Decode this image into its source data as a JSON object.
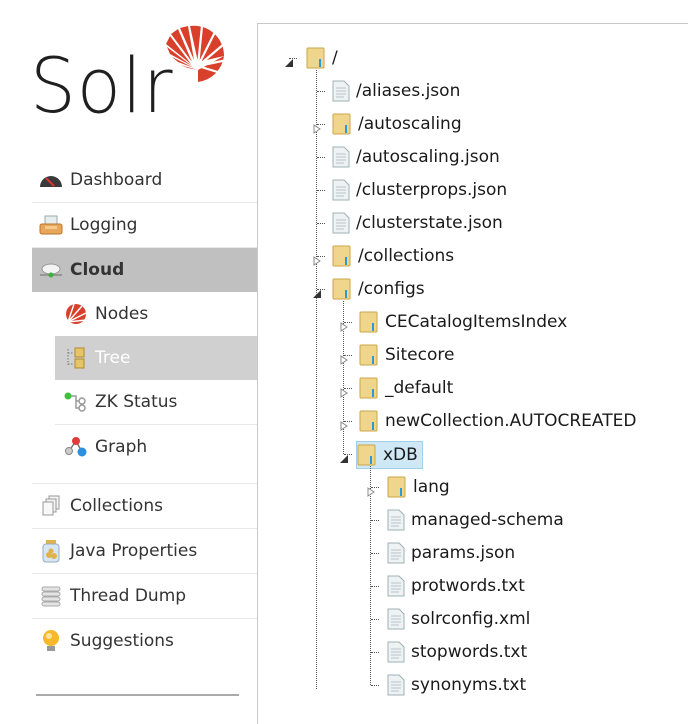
{
  "app": {
    "logo_text": "Solr",
    "brand_color": "#d9402b"
  },
  "sidebar": {
    "items": [
      {
        "label": "Dashboard",
        "icon": "dashboard-gauge-icon"
      },
      {
        "label": "Logging",
        "icon": "logging-tray-icon"
      },
      {
        "label": "Cloud",
        "icon": "cloud-icon",
        "active": true
      },
      {
        "label": "Collections",
        "icon": "collections-icon"
      },
      {
        "label": "Java Properties",
        "icon": "java-jar-icon"
      },
      {
        "label": "Thread Dump",
        "icon": "thread-dump-icon"
      },
      {
        "label": "Suggestions",
        "icon": "lightbulb-icon"
      }
    ],
    "cloud_sub_items": [
      {
        "label": "Nodes",
        "icon": "solr-nodes-icon"
      },
      {
        "label": "Tree",
        "icon": "tree-icon",
        "selected": true
      },
      {
        "label": "ZK Status",
        "icon": "zk-status-icon"
      },
      {
        "label": "Graph",
        "icon": "graph-icon"
      }
    ]
  },
  "tree": {
    "root": {
      "label": "/",
      "type": "folder",
      "expanded": true
    },
    "children": [
      {
        "label": "/aliases.json",
        "type": "file"
      },
      {
        "label": "/autoscaling",
        "type": "folder",
        "expanded": false
      },
      {
        "label": "/autoscaling.json",
        "type": "file"
      },
      {
        "label": "/clusterprops.json",
        "type": "file"
      },
      {
        "label": "/clusterstate.json",
        "type": "file"
      },
      {
        "label": "/collections",
        "type": "folder",
        "expanded": false
      },
      {
        "label": "/configs",
        "type": "folder",
        "expanded": true
      }
    ],
    "configs_children": [
      {
        "label": "CECatalogItemsIndex",
        "type": "folder",
        "expanded": false
      },
      {
        "label": "Sitecore",
        "type": "folder",
        "expanded": false
      },
      {
        "label": "_default",
        "type": "folder",
        "expanded": false
      },
      {
        "label": "newCollection.AUTOCREATED",
        "type": "folder",
        "expanded": false
      },
      {
        "label": "xDB",
        "type": "folder",
        "expanded": true,
        "selected": true
      }
    ],
    "xdb_children": [
      {
        "label": "lang",
        "type": "folder",
        "expanded": false
      },
      {
        "label": "managed-schema",
        "type": "file"
      },
      {
        "label": "params.json",
        "type": "file"
      },
      {
        "label": "protwords.txt",
        "type": "file"
      },
      {
        "label": "solrconfig.xml",
        "type": "file"
      },
      {
        "label": "stopwords.txt",
        "type": "file"
      },
      {
        "label": "synonyms.txt",
        "type": "file"
      }
    ]
  }
}
